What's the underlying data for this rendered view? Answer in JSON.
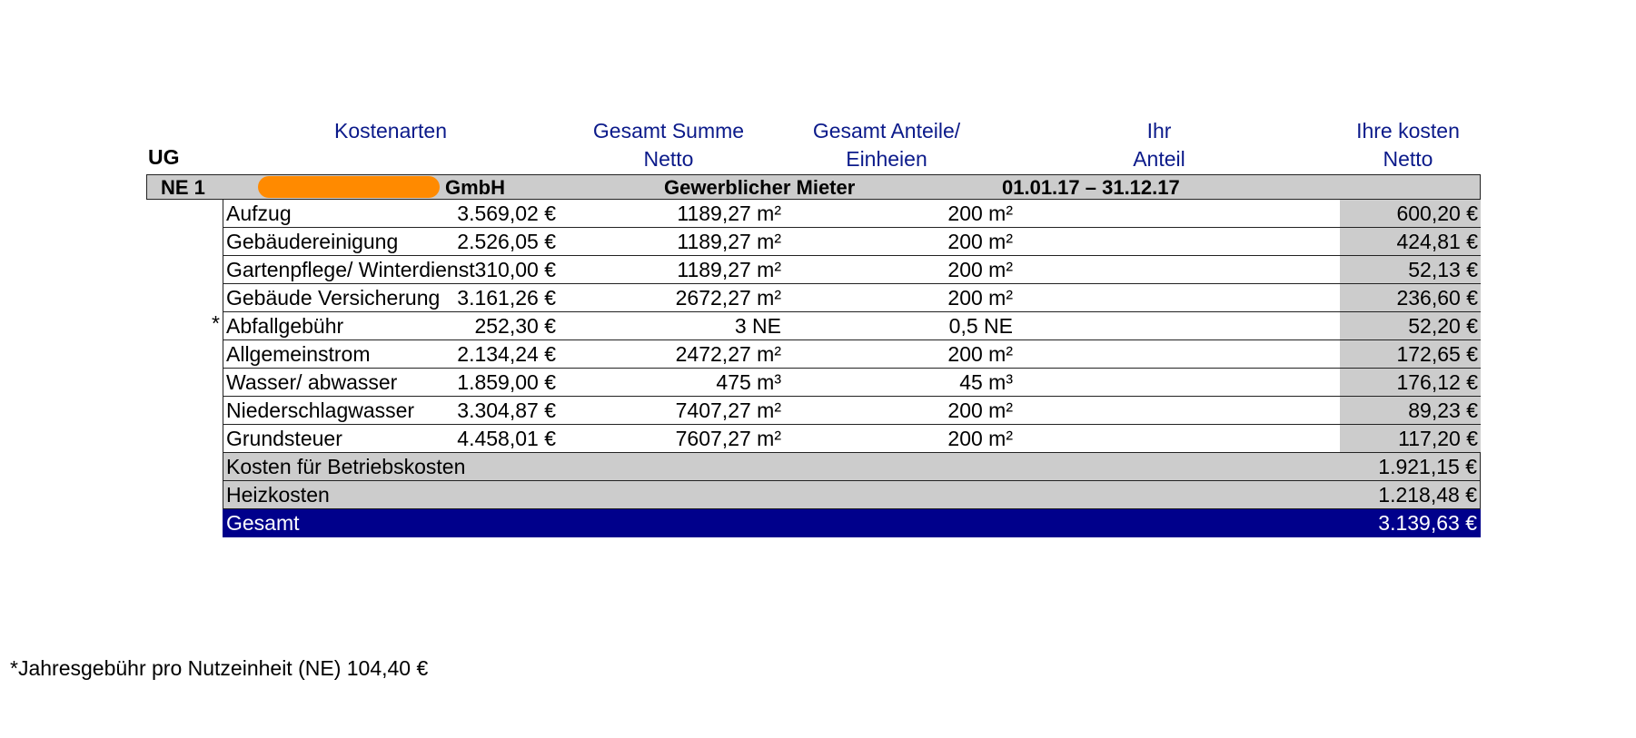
{
  "headers": {
    "kostenarten": "Kostenarten",
    "gesamt_summe": [
      "Gesamt Summe",
      "Netto"
    ],
    "gesamt_anteile": [
      "Gesamt Anteile/",
      "Einheien"
    ],
    "ihr_anteil": [
      "Ihr",
      "Anteil"
    ],
    "ihre_kosten": [
      "Ihre kosten",
      "Netto"
    ]
  },
  "section_label": "UG",
  "tenant": {
    "unit": "NE 1",
    "company_suffix": "GmbH",
    "redacted": true,
    "type": "Gewerblicher Mieter",
    "period": "01.01.17 – 31.12.17"
  },
  "rows": [
    {
      "name": "Aufzug",
      "sum": "3.569,02 €",
      "units": "1189,27 m²",
      "share": "200 m²",
      "amount": "600,20 €"
    },
    {
      "name": "Gebäudereinigung",
      "sum": "2.526,05 €",
      "units": "1189,27 m²",
      "share": "200 m²",
      "amount": "424,81 €"
    },
    {
      "name": "Gartenpflege/ Winterdienst",
      "sum": "310,00 €",
      "units": "1189,27 m²",
      "share": "200 m²",
      "amount": "52,13 €"
    },
    {
      "name": "Gebäude Versicherung",
      "sum": "3.161,26 €",
      "units": "2672,27 m²",
      "share": "200 m²",
      "amount": "236,60 €"
    },
    {
      "name": "Abfallgebühr",
      "sum": "252,30 €",
      "units": "3 NE",
      "share": "0,5 NE",
      "amount": "52,20 €"
    },
    {
      "name": "Allgemeinstrom",
      "sum": "2.134,24 €",
      "units": "2472,27 m²",
      "share": "200 m²",
      "amount": "172,65 €"
    },
    {
      "name": "Wasser/ abwasser",
      "sum": "1.859,00 €",
      "units": "475 m³",
      "share": "45 m³",
      "amount": "176,12 €"
    },
    {
      "name": "Niederschlagwasser",
      "sum": "3.304,87 €",
      "units": "7407,27 m²",
      "share": "200 m²",
      "amount": "89,23 €"
    },
    {
      "name": "Grundsteuer",
      "sum": "4.458,01 €",
      "units": "7607,27 m²",
      "share": "200 m²",
      "amount": "117,20 €"
    }
  ],
  "summary": {
    "betriebskosten_label": "Kosten für Betriebskosten",
    "betriebskosten_value": "1.921,15 €",
    "heizkosten_label": "Heizkosten",
    "heizkosten_value": "1.218,48 €",
    "gesamt_label": "Gesamt",
    "gesamt_value": "3.139,63 €"
  },
  "asterisk": "*",
  "footnote": "*Jahresgebühr pro Nutzeinheit (NE) 104,40 €"
}
